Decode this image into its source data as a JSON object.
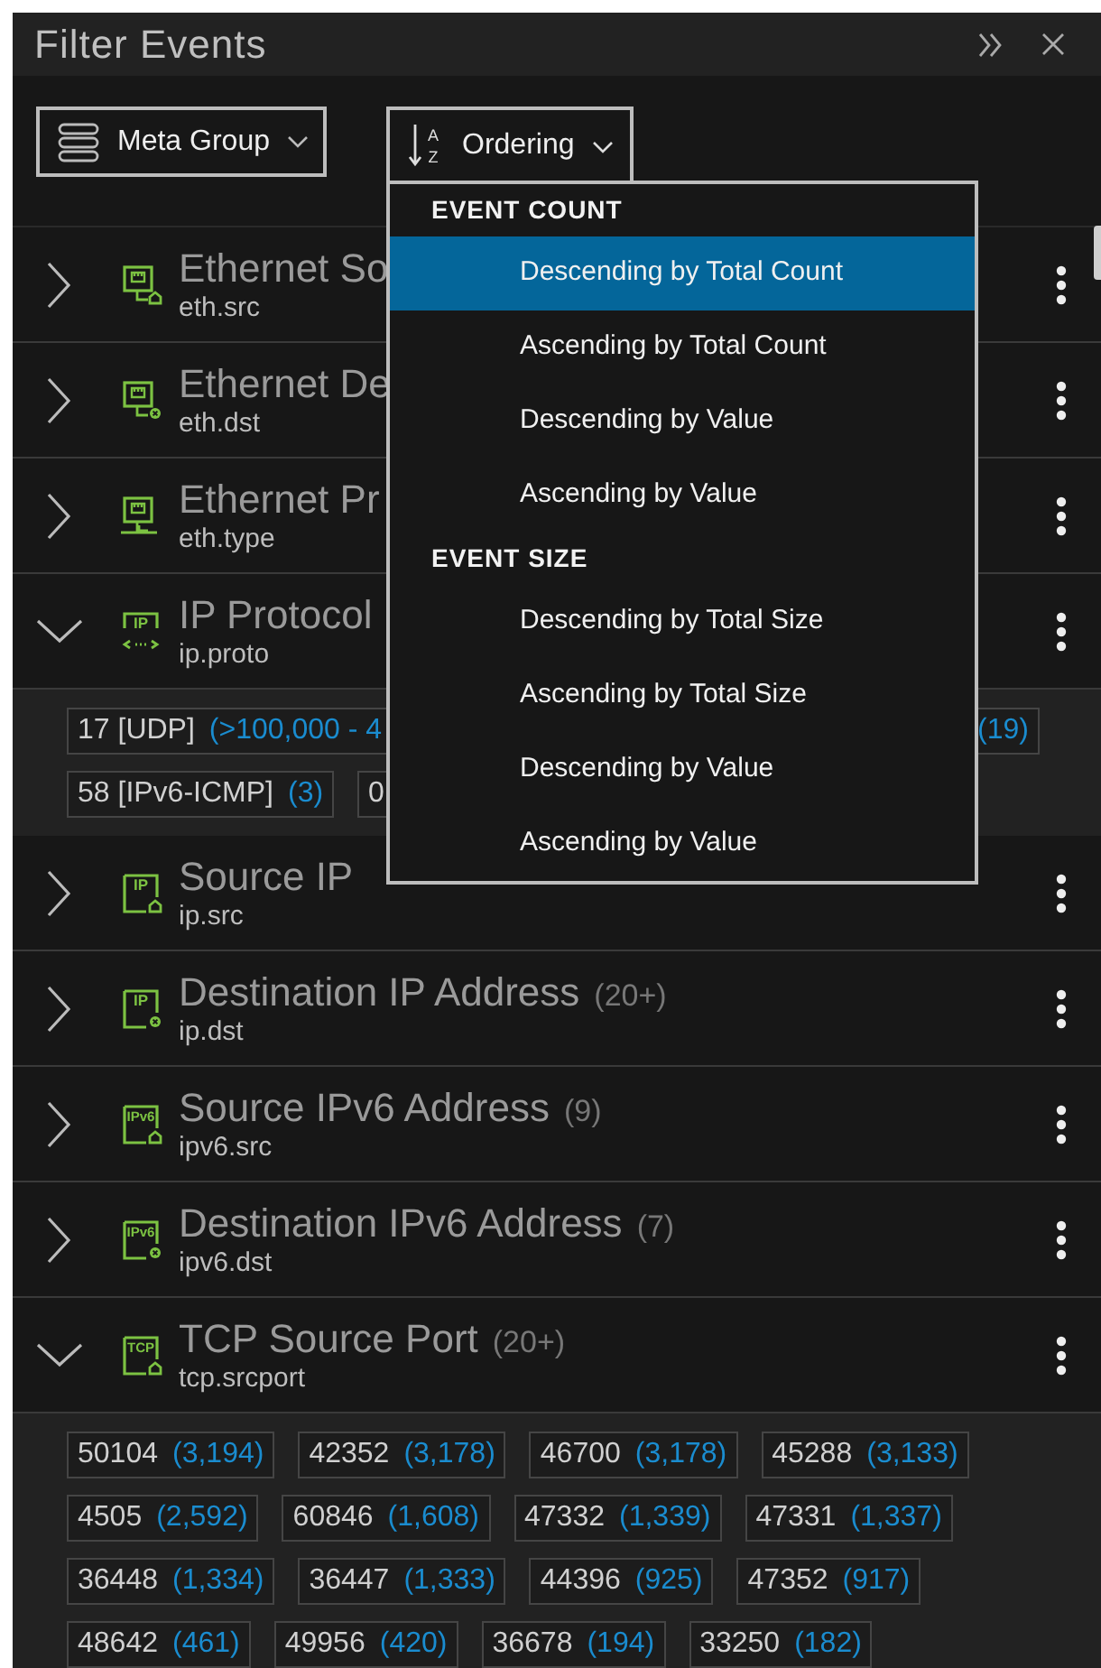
{
  "panel": {
    "title": "Filter Events"
  },
  "toolbar": {
    "meta_group": {
      "label": "Meta Group"
    },
    "ordering": {
      "label": "Ordering",
      "icon_letters": [
        "A",
        "Z"
      ]
    }
  },
  "groups": [
    {
      "title": "Ethernet So",
      "field": "eth.src",
      "expanded": false,
      "icon": {
        "kind": "ethernet",
        "role": {
          "kind": "source"
        }
      }
    },
    {
      "title": "Ethernet De",
      "field": "eth.dst",
      "expanded": false,
      "icon": {
        "kind": "ethernet",
        "role": {
          "kind": "destination"
        }
      }
    },
    {
      "title": "Ethernet Pr",
      "field": "eth.type",
      "expanded": false,
      "icon": {
        "kind": "ethernet",
        "role": {
          "kind": "type"
        }
      }
    },
    {
      "title": "IP Protocol",
      "field": "ip.proto",
      "expanded": true,
      "icon": {
        "kind": "label",
        "label": "IP",
        "role": {
          "kind": "protocol"
        }
      },
      "value_rows": [
        [
          {
            "value": "17 [UDP]",
            "count": "(>100,000 - 4"
          },
          {
            "count": "(19)"
          }
        ],
        [
          {
            "value": "58 [IPv6-ICMP]",
            "count": "(3)"
          },
          {
            "value": "0"
          }
        ]
      ]
    },
    {
      "title": "Source IP",
      "field": "ip.src",
      "expanded": false,
      "icon": {
        "kind": "label",
        "label": "IP",
        "role": {
          "kind": "source"
        }
      }
    },
    {
      "title": "Destination IP Address",
      "count": "(20+)",
      "field": "ip.dst",
      "expanded": false,
      "icon": {
        "kind": "label",
        "label": "IP",
        "role": {
          "kind": "destination"
        }
      }
    },
    {
      "title": "Source IPv6 Address",
      "count": "(9)",
      "field": "ipv6.src",
      "expanded": false,
      "icon": {
        "kind": "label",
        "label": "IPv6",
        "role": {
          "kind": "source"
        }
      }
    },
    {
      "title": "Destination IPv6 Address",
      "count": "(7)",
      "field": "ipv6.dst",
      "expanded": false,
      "icon": {
        "kind": "label",
        "label": "IPv6",
        "role": {
          "kind": "destination"
        }
      }
    },
    {
      "title": "TCP Source Port",
      "count": "(20+)",
      "field": "tcp.srcport",
      "expanded": true,
      "icon": {
        "kind": "label",
        "label": "TCP",
        "role": {
          "kind": "source"
        }
      },
      "value_rows": [
        [
          {
            "value": "50104",
            "count": "(3,194)"
          },
          {
            "value": "42352",
            "count": "(3,178)"
          },
          {
            "value": "46700",
            "count": "(3,178)"
          },
          {
            "value": "45288",
            "count": "(3,133)"
          }
        ],
        [
          {
            "value": "4505",
            "count": "(2,592)"
          },
          {
            "value": "60846",
            "count": "(1,608)"
          },
          {
            "value": "47332",
            "count": "(1,339)"
          },
          {
            "value": "47331",
            "count": "(1,337)"
          }
        ],
        [
          {
            "value": "36448",
            "count": "(1,334)"
          },
          {
            "value": "36447",
            "count": "(1,333)"
          },
          {
            "value": "44396",
            "count": "(925)"
          },
          {
            "value": "47352",
            "count": "(917)"
          }
        ],
        [
          {
            "value": "48642",
            "count": "(461)"
          },
          {
            "value": "49956",
            "count": "(420)"
          },
          {
            "value": "36678",
            "count": "(194)"
          },
          {
            "value": "33250",
            "count": "(182)"
          }
        ]
      ]
    }
  ],
  "ordering_menu": {
    "sections": [
      {
        "header": "EVENT COUNT",
        "items": [
          {
            "label": "Descending by Total Count",
            "selected": true
          },
          {
            "label": "Ascending by Total Count",
            "selected": false
          },
          {
            "label": "Descending by Value",
            "selected": false
          },
          {
            "label": "Ascending by Value",
            "selected": false
          }
        ]
      },
      {
        "header": "EVENT SIZE",
        "items": [
          {
            "label": "Descending by Total Size",
            "selected": false
          },
          {
            "label": "Ascending by Total Size",
            "selected": false
          },
          {
            "label": "Descending by Value",
            "selected": false
          },
          {
            "label": "Ascending by Value",
            "selected": false
          }
        ]
      }
    ]
  }
}
